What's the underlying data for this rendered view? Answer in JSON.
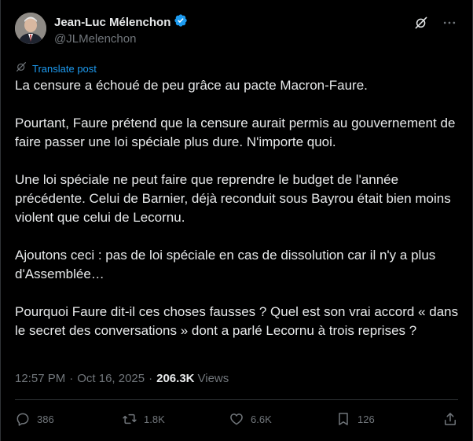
{
  "author": {
    "display_name": "Jean-Luc Mélenchon",
    "handle": "@JLMelenchon",
    "verified_color": "#1d9bf0"
  },
  "header_icons": [
    "grok-icon",
    "more-icon"
  ],
  "translate": {
    "label": "Translate post"
  },
  "post": {
    "paragraphs": [
      "La censure a échoué de peu grâce au pacte Macron-Faure.",
      "Pourtant, Faure prétend que la censure aurait permis au gouvernement de faire passer une loi spéciale plus dure. N'importe quoi.",
      "Une loi spéciale ne peut faire que reprendre le budget de l'année précédente. Celui de Barnier, déjà reconduit sous Bayrou était bien moins violent que celui de Lecornu.",
      "Ajoutons ceci : pas de loi spéciale en cas de dissolution car il n'y a plus d'Assemblée…",
      "Pourquoi Faure dit-il ces choses fausses ? Quel est son vrai accord « dans le secret des conversations » dont a parlé Lecornu à trois reprises ?"
    ]
  },
  "meta": {
    "time": "12:57 PM",
    "date": "Oct 16, 2025",
    "separator": "·",
    "views_count": "206.3K",
    "views_label": "Views"
  },
  "actions": {
    "replies": "386",
    "reposts": "1.8K",
    "likes": "6.6K",
    "bookmarks": "126"
  },
  "colors": {
    "background": "#000000",
    "text": "#e7e9ea",
    "muted": "#71767b",
    "accent": "#1d9bf0",
    "border": "#2f3336"
  }
}
